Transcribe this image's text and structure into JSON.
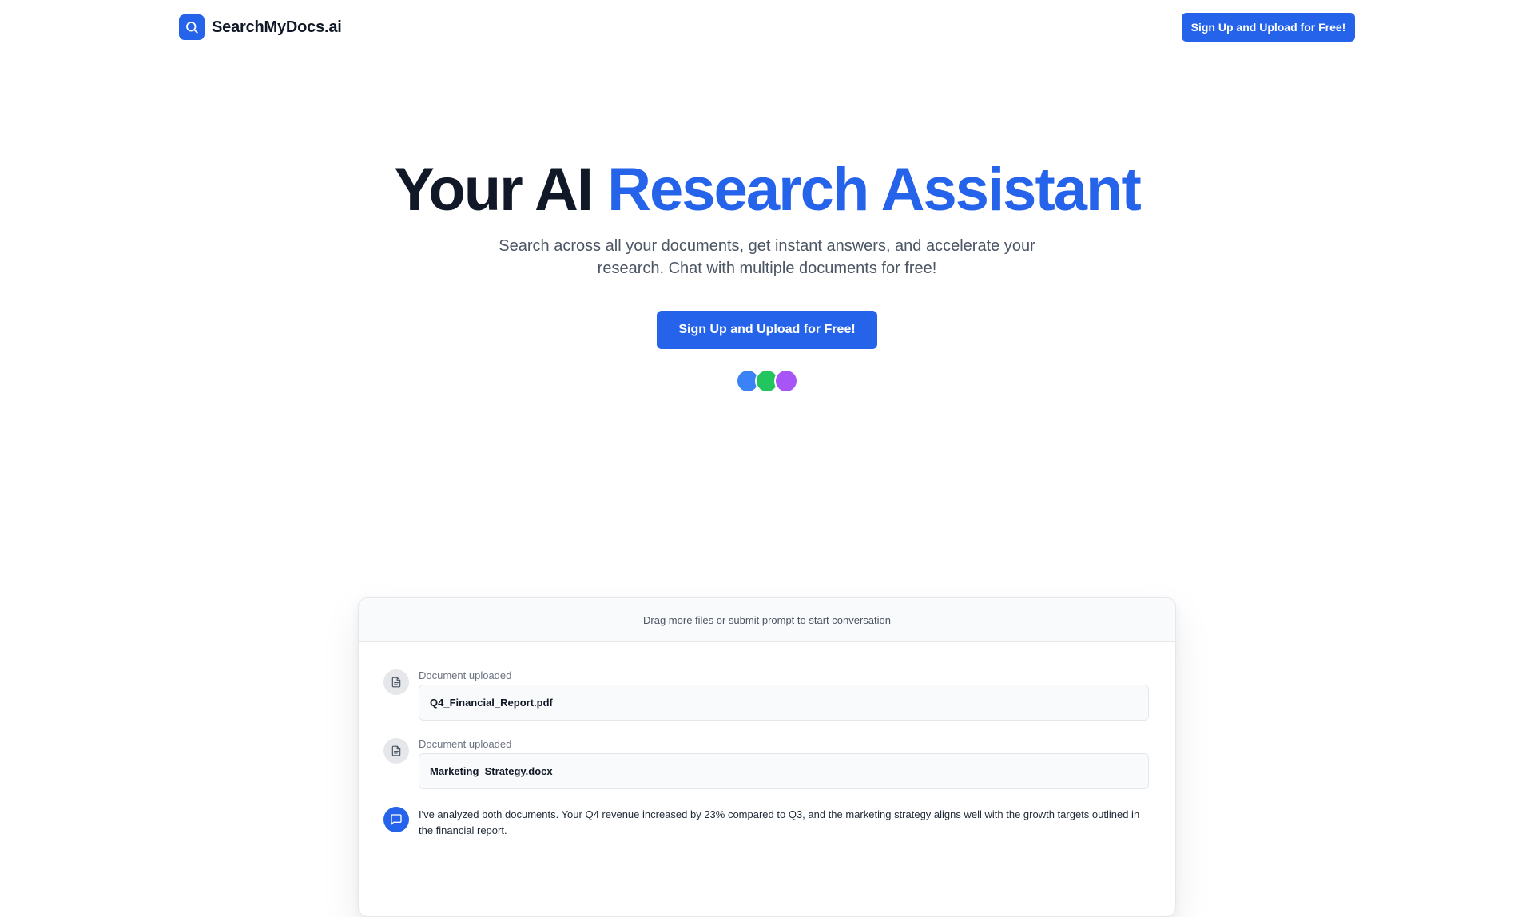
{
  "header": {
    "brand_name": "SearchMyDocs.ai",
    "logo_icon": "search-icon",
    "cta_label": "Sign Up and Upload for Free!"
  },
  "hero": {
    "title_part1": "Your AI",
    "title_part2": "Research Assistant",
    "subtitle": "Search across all your documents, get instant answers, and accelerate your research. Chat with multiple documents for free!",
    "cta_label": "Sign Up and Upload for Free!",
    "avatar_colors": [
      "#3b82f6",
      "#22c55e",
      "#a855f7"
    ]
  },
  "demo": {
    "header_text": "Drag more files or submit prompt to start conversation",
    "messages": [
      {
        "label": "Document uploaded",
        "file_name": "Q4_Financial_Report.pdf",
        "icon": "document-icon"
      },
      {
        "label": "Document uploaded",
        "file_name": "Marketing_Strategy.docx",
        "icon": "document-icon"
      }
    ],
    "assistant_reply": "I've analyzed both documents. Your Q4 revenue increased by 23% compared to Q3, and the marketing strategy aligns well with the growth targets outlined in the financial report.",
    "assistant_icon": "chat-bubble-icon"
  },
  "colors": {
    "accent": "#2563eb",
    "text_dark": "#111827",
    "text_muted": "#4b5563",
    "border": "#e5e7eb"
  }
}
